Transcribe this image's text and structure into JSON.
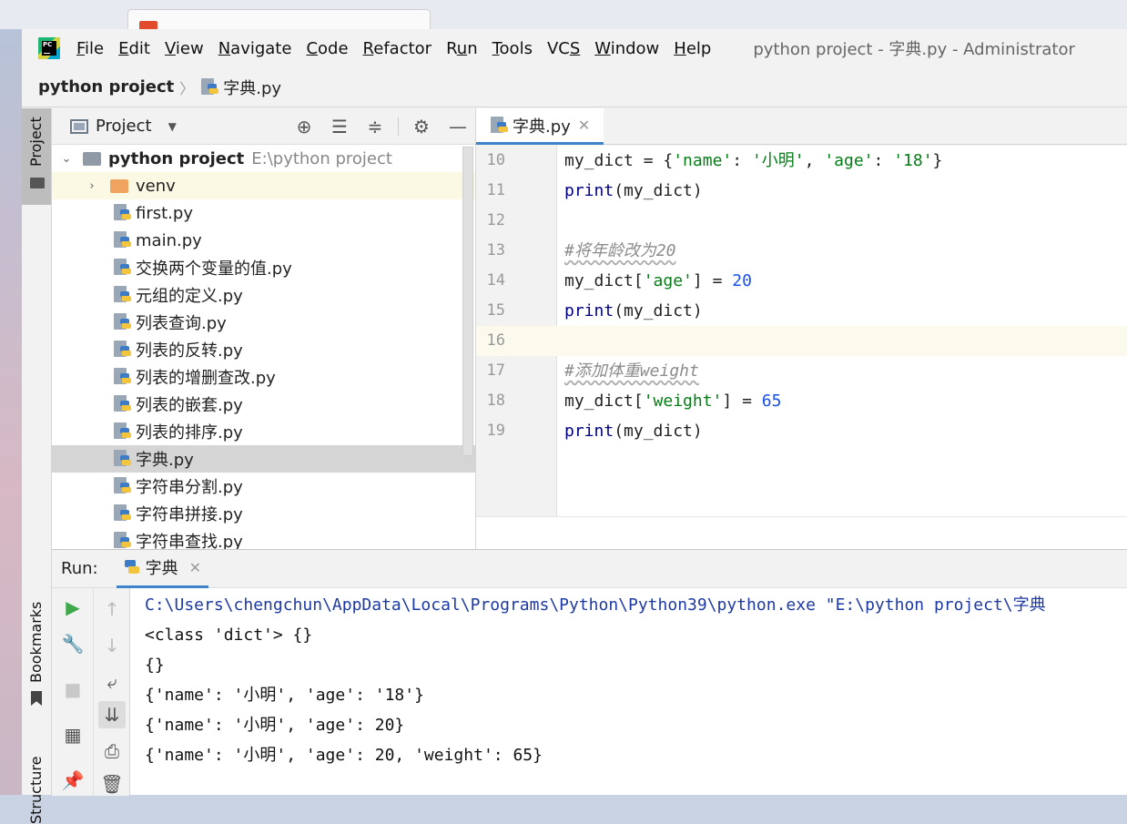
{
  "menubar": {
    "items": [
      {
        "label": "File",
        "mnemonic": "F",
        "rest": "ile"
      },
      {
        "label": "Edit",
        "mnemonic": "E",
        "rest": "dit"
      },
      {
        "label": "View",
        "mnemonic": "V",
        "rest": "iew"
      },
      {
        "label": "Navigate",
        "mnemonic": "N",
        "rest": "avigate"
      },
      {
        "label": "Code",
        "mnemonic": "C",
        "rest": "ode"
      },
      {
        "label": "Refactor",
        "mnemonic": "R",
        "rest": "efactor"
      },
      {
        "label": "Run",
        "mnemonic": "",
        "pre": "R",
        "mnem2": "u",
        "rest": "n"
      },
      {
        "label": "Tools",
        "mnemonic": "T",
        "rest": "ools"
      },
      {
        "label": "VCS",
        "pre": "VC",
        "mnem2": "S",
        "rest": ""
      },
      {
        "label": "Window",
        "mnemonic": "W",
        "rest": "indow"
      },
      {
        "label": "Help",
        "mnemonic": "H",
        "rest": "elp"
      }
    ],
    "window_title": "python project - 字典.py - Administrator"
  },
  "breadcrumb": {
    "project": "python project",
    "file": "字典.py"
  },
  "left_strip": {
    "project_label": "Project",
    "bookmarks_label": "Bookmarks",
    "structure_label": "Structure"
  },
  "project_panel": {
    "title": "Project",
    "root": {
      "name": "python project",
      "path": "E:\\python project"
    },
    "folders": [
      "venv"
    ],
    "files": [
      "first.py",
      "main.py",
      "交换两个变量的值.py",
      "元组的定义.py",
      "列表查询.py",
      "列表的反转.py",
      "列表的增删查改.py",
      "列表的嵌套.py",
      "列表的排序.py",
      "字典.py",
      "字符串分割.py",
      "字符串拼接.py",
      "字符串查找.py"
    ],
    "selected_file": "字典.py"
  },
  "editor": {
    "tab_label": "字典.py",
    "current_line": 16,
    "lines": [
      {
        "n": "10",
        "text": "my_dict = {'name': '小明', 'age': '18'}"
      },
      {
        "n": "11",
        "text": "print(my_dict)"
      },
      {
        "n": "12",
        "text": ""
      },
      {
        "n": "13",
        "text": "#将年龄改为20"
      },
      {
        "n": "14",
        "text": "my_dict['age'] = 20"
      },
      {
        "n": "15",
        "text": "print(my_dict)"
      },
      {
        "n": "16",
        "text": ""
      },
      {
        "n": "17",
        "text": "#添加体重weight"
      },
      {
        "n": "18",
        "text": "my_dict['weight'] = 65"
      },
      {
        "n": "19",
        "text": "print(my_dict)"
      }
    ]
  },
  "run_panel": {
    "label": "Run:",
    "tab_label": "字典",
    "output": [
      "C:\\Users\\chengchun\\AppData\\Local\\Programs\\Python\\Python39\\python.exe \"E:\\python project\\字典",
      "<class 'dict'> {}",
      "{}",
      "{'name': '小明', 'age': '18'}",
      "{'name': '小明', 'age': 20}",
      "{'name': '小明', 'age': 20, 'weight': 65}"
    ]
  },
  "colors": {
    "keyword": "#000080",
    "string": "#067d17",
    "number": "#1750eb",
    "comment": "#8c8c8c",
    "accent": "#4083c9"
  }
}
